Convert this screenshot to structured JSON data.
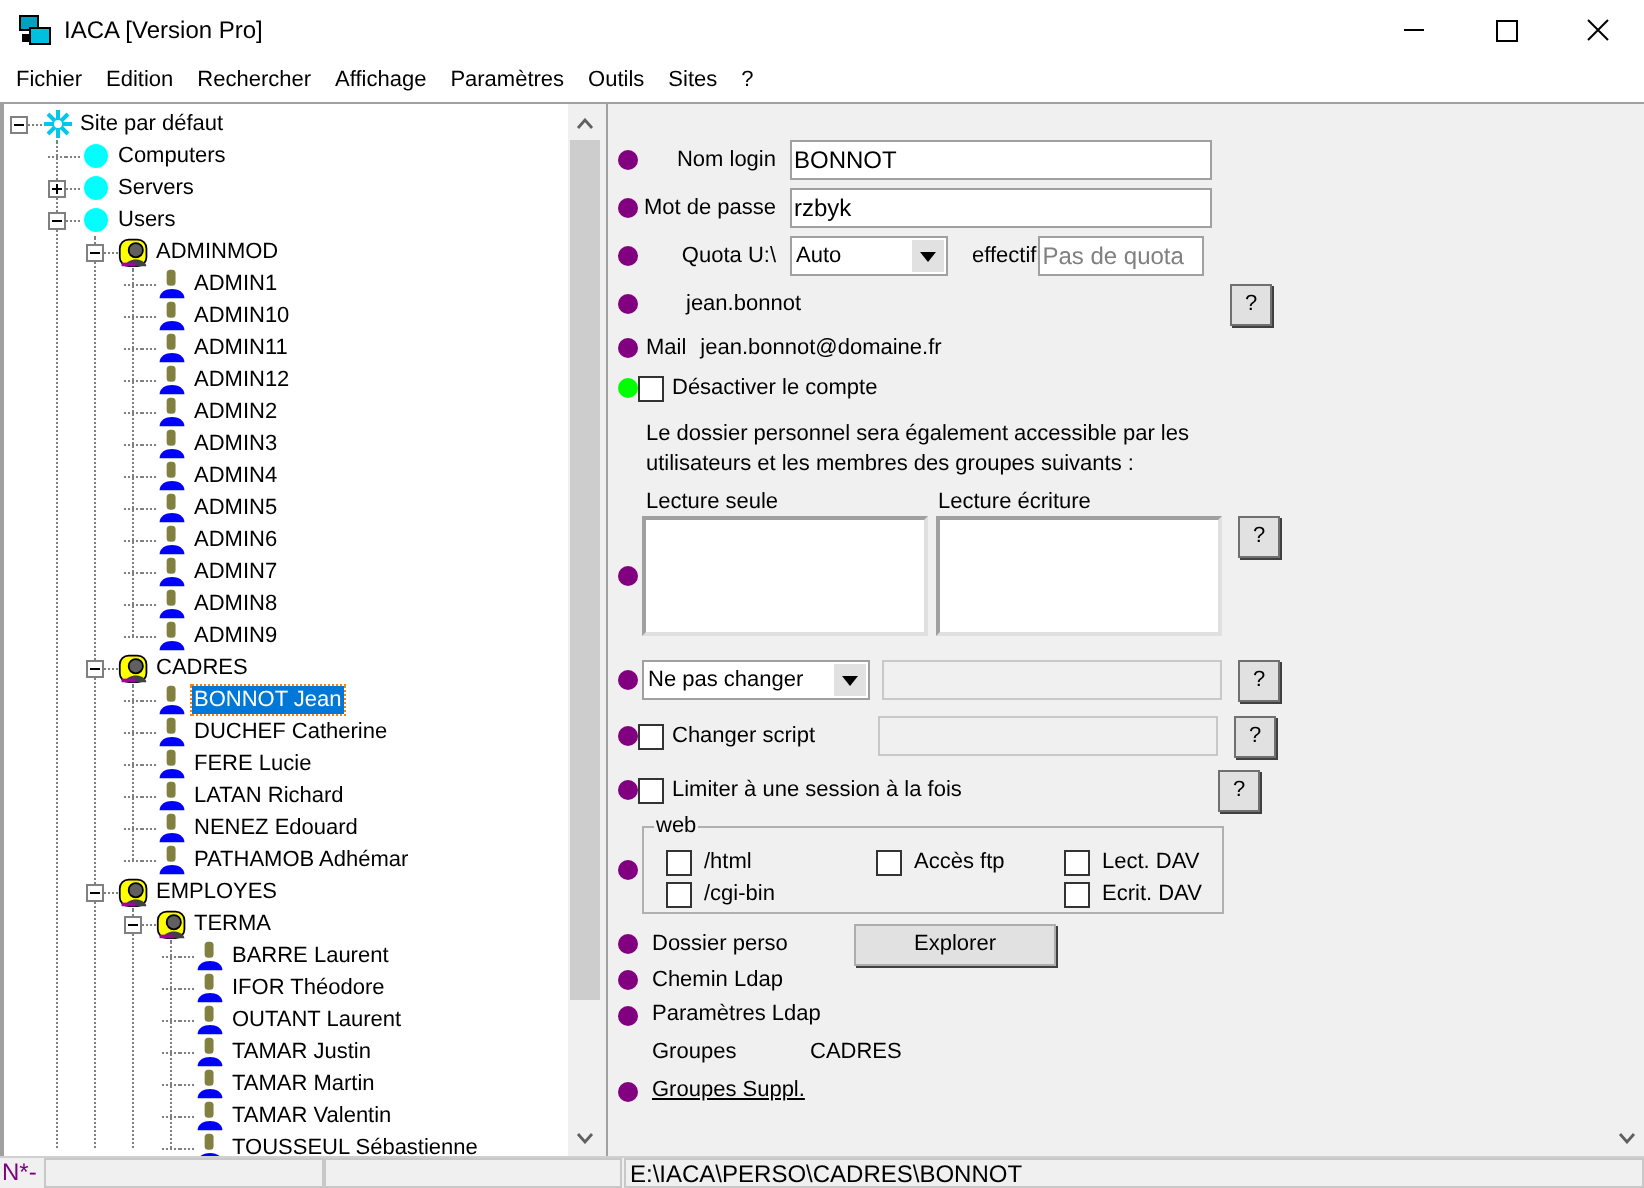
{
  "window": {
    "title": "IACA [Version Pro]"
  },
  "menu": [
    {
      "label": "Fichier"
    },
    {
      "label": "Edition"
    },
    {
      "label": "Rechercher"
    },
    {
      "label": "Affichage"
    },
    {
      "label": "Paramètres"
    },
    {
      "label": "Outils"
    },
    {
      "label": "Sites"
    },
    {
      "label": "?"
    }
  ],
  "tree": [
    {
      "label": "Site par défaut",
      "kind": "site",
      "expanded": true,
      "selected": false,
      "children": [
        {
          "label": "Computers",
          "kind": "container",
          "selected": false
        },
        {
          "label": "Servers",
          "kind": "container",
          "expanded": false,
          "selected": false
        },
        {
          "label": "Users",
          "kind": "container",
          "expanded": true,
          "selected": false,
          "children": [
            {
              "label": "ADMINMOD",
              "kind": "group",
              "expanded": true,
              "selected": false,
              "children": [
                {
                  "label": "ADMIN1",
                  "kind": "user",
                  "selected": false
                },
                {
                  "label": "ADMIN10",
                  "kind": "user",
                  "selected": false
                },
                {
                  "label": "ADMIN11",
                  "kind": "user",
                  "selected": false
                },
                {
                  "label": "ADMIN12",
                  "kind": "user",
                  "selected": false
                },
                {
                  "label": "ADMIN2",
                  "kind": "user",
                  "selected": false
                },
                {
                  "label": "ADMIN3",
                  "kind": "user",
                  "selected": false
                },
                {
                  "label": "ADMIN4",
                  "kind": "user",
                  "selected": false
                },
                {
                  "label": "ADMIN5",
                  "kind": "user",
                  "selected": false
                },
                {
                  "label": "ADMIN6",
                  "kind": "user",
                  "selected": false
                },
                {
                  "label": "ADMIN7",
                  "kind": "user",
                  "selected": false
                },
                {
                  "label": "ADMIN8",
                  "kind": "user",
                  "selected": false
                },
                {
                  "label": "ADMIN9",
                  "kind": "user",
                  "selected": false
                }
              ]
            },
            {
              "label": "CADRES",
              "kind": "group",
              "expanded": true,
              "selected": false,
              "children": [
                {
                  "label": "BONNOT Jean",
                  "kind": "user",
                  "selected": true
                },
                {
                  "label": "DUCHEF Catherine",
                  "kind": "user",
                  "selected": false
                },
                {
                  "label": "FERE Lucie",
                  "kind": "user",
                  "selected": false
                },
                {
                  "label": "LATAN Richard",
                  "kind": "user",
                  "selected": false
                },
                {
                  "label": "NENEZ Edouard",
                  "kind": "user",
                  "selected": false
                },
                {
                  "label": "PATHAMOB Adhémar",
                  "kind": "user",
                  "selected": false
                }
              ]
            },
            {
              "label": "EMPLOYES",
              "kind": "group",
              "expanded": true,
              "selected": false,
              "children": [
                {
                  "label": "TERMA",
                  "kind": "group",
                  "expanded": true,
                  "selected": false,
                  "children": [
                    {
                      "label": "BARRE Laurent",
                      "kind": "user",
                      "selected": false
                    },
                    {
                      "label": "IFOR Théodore",
                      "kind": "user",
                      "selected": false
                    },
                    {
                      "label": "OUTANT Laurent",
                      "kind": "user",
                      "selected": false
                    },
                    {
                      "label": "TAMAR Justin",
                      "kind": "user",
                      "selected": false
                    },
                    {
                      "label": "TAMAR Martin",
                      "kind": "user",
                      "selected": false
                    },
                    {
                      "label": "TAMAR Valentin",
                      "kind": "user",
                      "selected": false
                    },
                    {
                      "label": "TOUSSEUL Sébastienne",
                      "kind": "user",
                      "selected": false
                    }
                  ]
                }
              ]
            }
          ]
        }
      ]
    }
  ],
  "form": {
    "login": {
      "label": "Nom login",
      "value": "BONNOT",
      "color": "#800080"
    },
    "password": {
      "label": "Mot de passe",
      "value": "rzbyk",
      "color": "#800080"
    },
    "quota": {
      "label": "Quota U:\\",
      "value": "Auto",
      "effective_label": "effectif",
      "effective_placeholder": "Pas de quota",
      "color": "#800080"
    },
    "account": {
      "value": "jean.bonnot",
      "help": "?",
      "color": "#800080"
    },
    "mail": {
      "label": "Mail",
      "value": "jean.bonnot@domaine.fr",
      "color": "#800080"
    },
    "disable": {
      "label": "Désactiver le compte",
      "checked": false,
      "color": "#00ff00"
    },
    "info": "Le dossier personnel sera également accessible par les utilisateurs et les membres des groupes suivants :",
    "access": {
      "read_label": "Lecture seule",
      "write_label": "Lecture écriture",
      "help": "?",
      "color": "#800080"
    },
    "change": {
      "value": "Ne pas changer",
      "help": "?",
      "color": "#800080"
    },
    "script": {
      "label": "Changer script",
      "checked": false,
      "help": "?",
      "color": "#800080"
    },
    "session": {
      "label": "Limiter à une session à la fois",
      "checked": false,
      "help": "?",
      "color": "#800080"
    },
    "web": {
      "title": "web",
      "color": "#800080",
      "options": [
        {
          "label": "/html",
          "checked": false
        },
        {
          "label": "Accès ftp",
          "checked": false
        },
        {
          "label": "Lect. DAV",
          "checked": false
        },
        {
          "label": "/cgi-bin",
          "checked": false
        },
        {
          "label": "Ecrit. DAV",
          "checked": false
        }
      ]
    },
    "home": {
      "label": "Dossier perso",
      "button": "Explorer",
      "color": "#800080"
    },
    "ldap_path": {
      "label": "Chemin Ldap",
      "color": "#800080"
    },
    "ldap_params": {
      "label": "Paramètres Ldap",
      "color": "#800080"
    },
    "groups": {
      "label": "Groupes",
      "value": "CADRES"
    },
    "extra_groups": {
      "label": "Groupes Suppl.",
      "color": "#800080"
    }
  },
  "status_bar": {
    "mode": "N*-",
    "path": "E:\\IACA\\PERSO\\CADRES\\BONNOT"
  }
}
